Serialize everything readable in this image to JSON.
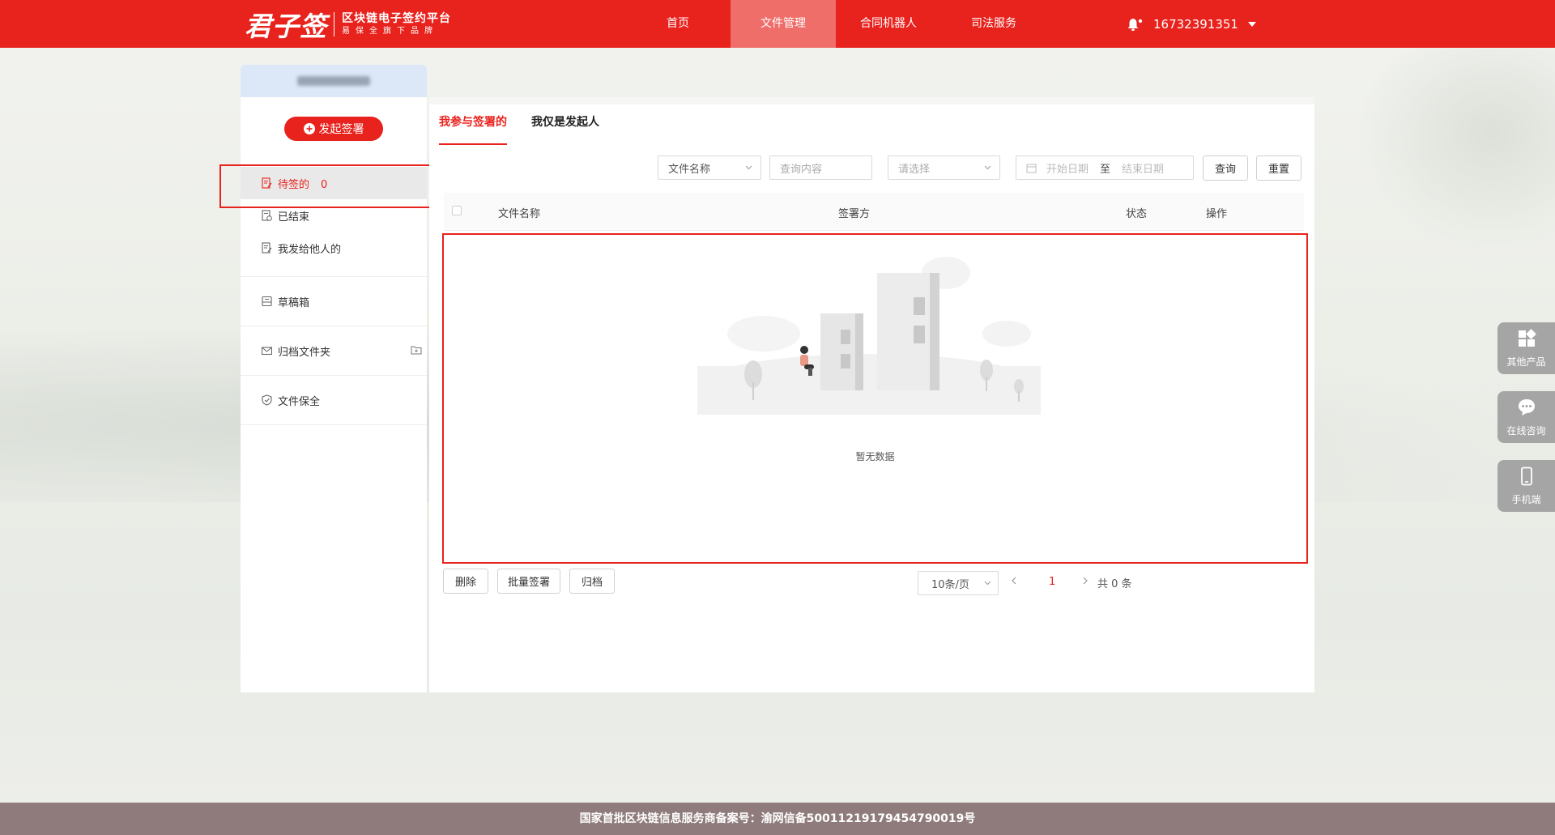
{
  "header": {
    "logo_main": "君子签",
    "logo_sub_title": "区块链电子签约平台",
    "logo_sub_slogan": "易保全旗下品牌",
    "nav": [
      "首页",
      "文件管理",
      "合同机器人",
      "司法服务"
    ],
    "active_nav": "文件管理",
    "phone": "16732391351"
  },
  "sidebar": {
    "start_button": "发起签署",
    "items": [
      {
        "label": "待签的",
        "count": "0",
        "icon": "document-edit-icon"
      },
      {
        "label": "已结束",
        "icon": "document-done-icon"
      },
      {
        "label": "我发给他人的",
        "icon": "document-send-icon"
      },
      {
        "label": "草稿箱",
        "icon": "draft-box-icon"
      },
      {
        "label": "归档文件夹",
        "icon": "envelope-icon"
      },
      {
        "label": "文件保全",
        "icon": "shield-check-icon"
      }
    ]
  },
  "main": {
    "tabs": [
      "我参与签署的",
      "我仅是发起人"
    ],
    "filters": {
      "field_select": "文件名称",
      "query_placeholder": "查询内容",
      "status_placeholder": "请选择",
      "start_date_placeholder": "开始日期",
      "range_separator": "至",
      "end_date_placeholder": "结束日期",
      "query_button": "查询",
      "reset_button": "重置"
    },
    "table": {
      "headers": [
        "文件名称",
        "签署方",
        "状态",
        "操作"
      ],
      "rows": [],
      "empty_text": "暂无数据"
    },
    "actions": [
      "删除",
      "批量签署",
      "归档"
    ],
    "pagination": {
      "page_size": "10条/页",
      "current_page": "1",
      "total": "共 0 条"
    }
  },
  "float_buttons": [
    {
      "label": "其他产品",
      "icon": "apps-icon"
    },
    {
      "label": "在线咨询",
      "icon": "chat-bubble-icon"
    },
    {
      "label": "手机端",
      "icon": "mobile-phone-icon"
    }
  ],
  "footer": {
    "text": "国家首批区块链信息服务商备案号：渝网信备50011219179454790019号"
  },
  "colors": {
    "brand_red": "#e8221d",
    "active_nav_bg": "#ef6e6a",
    "footer_bg": "#8f7b7b"
  }
}
